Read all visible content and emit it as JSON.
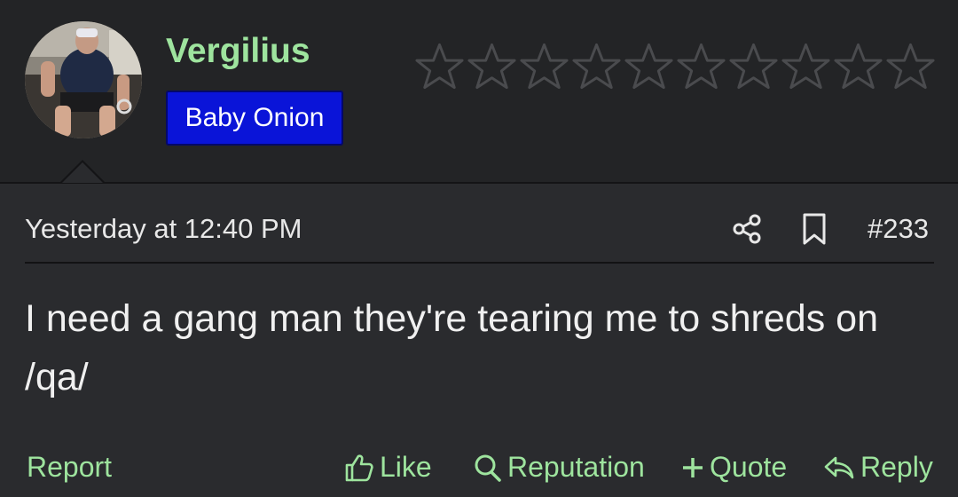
{
  "user": {
    "name": "Vergilius",
    "badge": "Baby Onion",
    "rating_max": 10,
    "rating_filled": 0
  },
  "post": {
    "timestamp": "Yesterday at 12:40 PM",
    "number": "#233",
    "body": "I need a gang man they're tearing me to shreds on /qa/"
  },
  "actions": {
    "report": "Report",
    "like": "Like",
    "reputation": "Reputation",
    "quote": "Quote",
    "reply": "Reply"
  },
  "colors": {
    "accent": "#9ee49e",
    "badge_bg": "#0a14d8",
    "background": "#2a2b2e",
    "header_bg": "#232426"
  },
  "icons": {
    "share": "share-icon",
    "bookmark": "bookmark-icon",
    "like": "thumbs-up-icon",
    "reputation": "search-icon",
    "quote": "plus-icon",
    "reply": "reply-arrow-icon"
  }
}
